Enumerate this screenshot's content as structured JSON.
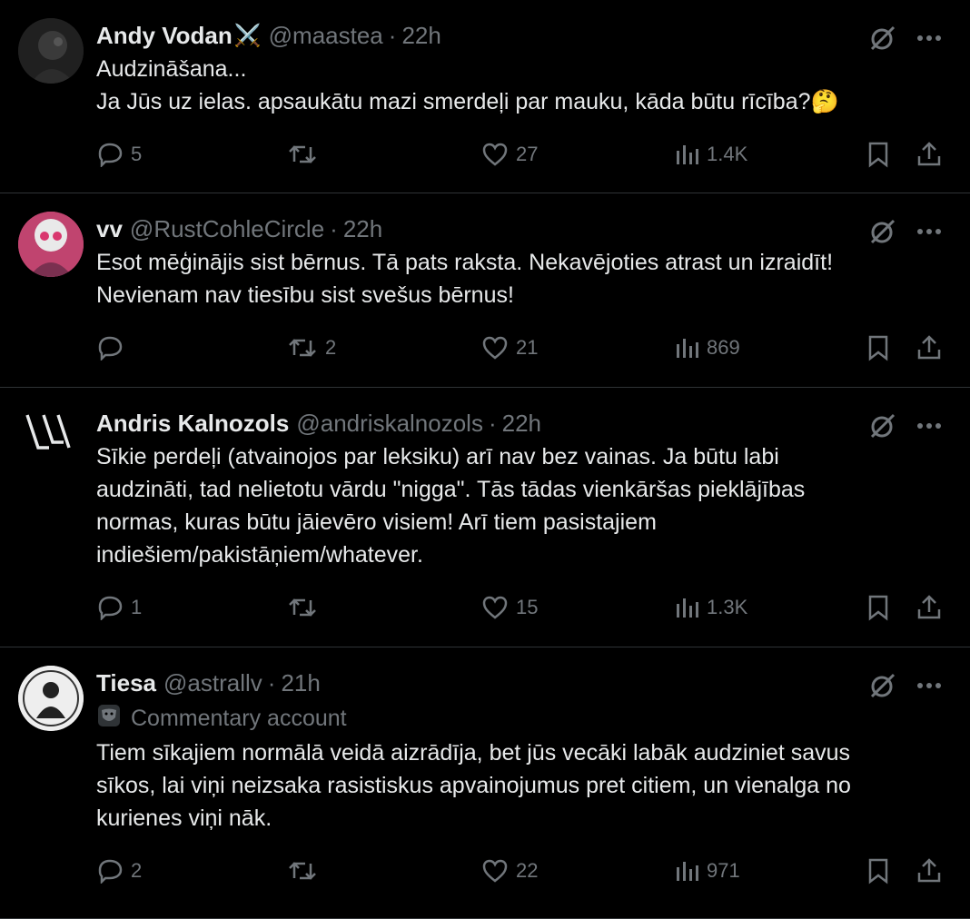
{
  "tweets": [
    {
      "name": "Andy Vodan",
      "name_emoji": "⚔️",
      "handle": "@maastea",
      "time": "22h",
      "badge": "",
      "text": "Audzināšana...\nJa Jūs uz ielas. apsaukātu mazi smerdeļi par mauku, kāda būtu rīcība?🤔",
      "replies": "5",
      "retweets": "",
      "likes": "27",
      "views": "1.4K"
    },
    {
      "name": "vv",
      "name_emoji": "",
      "handle": "@RustCohleCircle",
      "time": "22h",
      "badge": "",
      "text": "Esot mēģinājis sist bērnus. Tā pats raksta. Nekavējoties atrast un izraidīt!\nNevienam nav tiesību sist svešus bērnus!",
      "replies": "",
      "retweets": "2",
      "likes": "21",
      "views": "869"
    },
    {
      "name": "Andris Kalnozols",
      "name_emoji": "",
      "handle": "@andriskalnozols",
      "time": "22h",
      "badge": "",
      "text": "Sīkie perdeļi (atvainojos par leksiku) arī nav bez vainas. Ja būtu labi\naudzināti, tad nelietotu vārdu \"nigga\". Tās tādas vienkāršas pieklājības\nnormas, kuras būtu jāievēro visiem! Arī tiem pasistajiem\nindiešiem/pakistāņiem/whatever.",
      "replies": "1",
      "retweets": "",
      "likes": "15",
      "views": "1.3K"
    },
    {
      "name": "Tiesa",
      "name_emoji": "",
      "handle": "@astrallv",
      "time": "21h",
      "badge": "Commentary account",
      "text": "Tiem sīkajiem normālā veidā aizrādīja, bet jūs vecāki labāk audziniet savus\nsīkos, lai viņi neizsaka rasistiskus apvainojumus pret citiem, un vienalga no\nkurienes viņi nāk.",
      "replies": "2",
      "retweets": "",
      "likes": "22",
      "views": "971"
    }
  ],
  "icons": {
    "grok": "grok-icon",
    "more": "more-icon",
    "reply": "reply-icon",
    "retweet": "retweet-icon",
    "like": "heart-icon",
    "views": "views-icon",
    "bookmark": "bookmark-icon",
    "share": "share-icon",
    "badge": "theater-mask-icon"
  },
  "colors": {
    "background": "#000000",
    "text": "#e7e9ea",
    "muted": "#71767b",
    "divider": "#2f3336"
  }
}
